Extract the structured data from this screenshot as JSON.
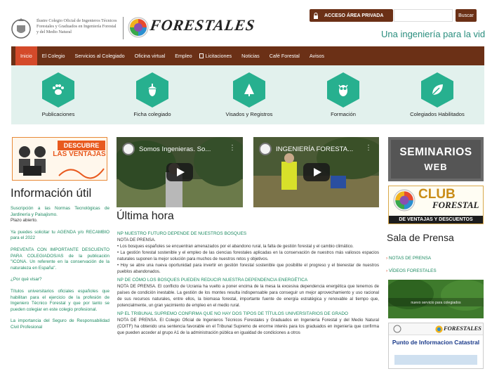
{
  "header": {
    "institution_name": "Ilustre Colegio Oficial de Ingenieros Técnicos Forestales y Graduados en Ingeniería Forestal y del Medio Natural",
    "logo_word": "FORESTALES",
    "acceso_label": "ACCESO ÁREA PRIVADA",
    "search_placeholder": "",
    "search_button": "Buscar",
    "tagline": "Una ingeniería para la vida"
  },
  "nav": {
    "items": [
      "Inicio",
      "El Colegio",
      "Servicios al Colegiado",
      "Oficina virtual",
      "Empleo",
      "Licitaciones",
      "Noticias",
      "Café Forestal",
      "Avisos"
    ],
    "active_index": 0
  },
  "quick_links": [
    "Publicaciones",
    "Ficha colegiado",
    "Visados y Registros",
    "Formación",
    "Colegiados Habilitados"
  ],
  "banners": {
    "descubre_line1": "DESCUBRE",
    "descubre_line2": "LAS VENTAJAS",
    "seminarios_line1": "SEMINARIOS",
    "seminarios_line2": "WEB",
    "club_line1": "CLUB",
    "club_line2": "FORESTAL",
    "club_line3": "DE VENTAJAS Y DESCUENTOS",
    "green_text": "nuevo servicio para colegiados",
    "punto_logo": "FORESTALES",
    "punto_text": "Punto de Informacion Catastral"
  },
  "videos": [
    {
      "title": "Somos Ingenieras. So..."
    },
    {
      "title": "INGENIERÍA FORESTA..."
    }
  ],
  "info_util": {
    "title": "Información útil",
    "items": [
      {
        "text": "Suscripción a las Normas Tecnológicas de Jardinería y Paisajismo.",
        "tail": "Plazo abierto."
      },
      {
        "text": "Ya puedes solicitar tu AGENDA y/o RECAMBIO para el 2022",
        "tail": ""
      },
      {
        "text": "PREVENTA CON IMPORTANTE DESCUENTO PARA COLEGIADOS/AS de la publicación \"ICONA. Un referente en la conservación de la naturaleza en España\".",
        "tail": ""
      },
      {
        "text": "¿Por qué visar?",
        "tail": ""
      },
      {
        "text": "Títulos universitarios oficiales españoles que habilitan para el ejercicio de la profesión de Ingeniero Técnico Forestal y que por tanto se pueden colegiar en este colegio profesional.",
        "tail": ""
      },
      {
        "text": "La importancia del Seguro de Responsabilidad Civil Profesional",
        "tail": ""
      }
    ]
  },
  "ultima_hora": {
    "title": "Última hora",
    "items": [
      {
        "headline": "NP NUESTRO FUTURO DEPENDE DE NUESTROS BOSQUES",
        "body": [
          "NOTA DE PRENSA.",
          "• Los bosques españoles se encuentran amenazados por el abandono rural, la falta de gestión forestal y el cambio climático.",
          "• La gestión forestal sostenible y el empleo de las ciencias forestales aplicadas en la conservación de nuestros más valiosos espacios naturales suponen la mejor solución para muchos de nuestros retos y objetivos.",
          "• Hoy se abre una nueva oportunidad para invertir en gestión forestal sostenible que posibilite el progreso y el bienestar de nuestros pueblos abandonados."
        ]
      },
      {
        "headline": "NP DE CÓMO LOS BOSQUES PUEDEN REDUCIR NUESTRA DEPENDENCIA ENERGÉTICA",
        "body": [
          "NOTA DE PRENSA. El conflicto de Ucrania ha vuelto a poner encima de la mesa la excesiva dependencia energética que tenemos de países de condición inestable. La gestión de los montes resulta indispensable para conseguir un mejor aprovechamiento y uso racional de sus recursos naturales, entre ellos, la biomasa forestal, importante fuente de energía estratégica y renovable al tiempo que, potencialmente, un gran yacimiento de empleo en el medio rural."
        ]
      },
      {
        "headline": "NP EL TRIBUNAL SUPREMO CONFIRMA QUE NO HAY DOS TIPOS DE TÍTULOS UNIVERSITARIOS DE GRADO",
        "body": [
          "NOTA DE PRENSA. El Colegio Oficial de Ingenieros Técnicos Forestales y Graduados en Ingeniería Forestal y del Medio Natural (COITF) ha obtenido una sentencia favorable en el Tribunal Supremo de enorme interés para los graduados en ingeniería que confirma que pueden acceder al grupo A1 de la administración pública en igualdad de condiciones a otros"
        ]
      }
    ]
  },
  "sala_prensa": {
    "title": "Sala de Prensa",
    "links": [
      "NOTAS DE PRENSA",
      "VÍDEOS FORESTALES"
    ]
  },
  "colors": {
    "nav_bg": "#6b3016",
    "nav_active": "#d44a2a",
    "accent_green": "#1d8a61",
    "icon_teal": "#27b08f",
    "iconbar_bg": "#e2f1ed"
  },
  "icons": [
    "paw-icon",
    "acorn-icon",
    "tree-icon",
    "owl-icon",
    "leaf-icon"
  ]
}
